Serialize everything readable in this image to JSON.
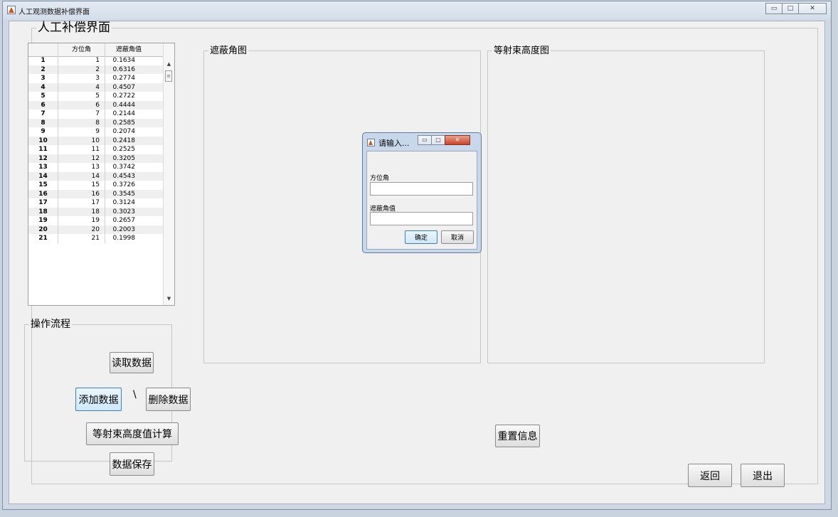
{
  "window": {
    "title": "人工观测数据补偿界面"
  },
  "main": {
    "title": "人工补偿界面"
  },
  "table": {
    "headers": [
      "",
      "方位角",
      "遮蔽角值"
    ],
    "rows": [
      [
        "1",
        "1",
        "0.1634"
      ],
      [
        "2",
        "2",
        "0.6316"
      ],
      [
        "3",
        "3",
        "0.2774"
      ],
      [
        "4",
        "4",
        "0.4507"
      ],
      [
        "5",
        "5",
        "0.2722"
      ],
      [
        "6",
        "6",
        "0.4444"
      ],
      [
        "7",
        "7",
        "0.2144"
      ],
      [
        "8",
        "8",
        "0.2585"
      ],
      [
        "9",
        "9",
        "0.2074"
      ],
      [
        "10",
        "10",
        "0.2418"
      ],
      [
        "11",
        "11",
        "0.2525"
      ],
      [
        "12",
        "12",
        "0.3205"
      ],
      [
        "13",
        "13",
        "0.3742"
      ],
      [
        "14",
        "14",
        "0.4543"
      ],
      [
        "15",
        "15",
        "0.3726"
      ],
      [
        "16",
        "16",
        "0.3545"
      ],
      [
        "17",
        "17",
        "0.3124"
      ],
      [
        "18",
        "18",
        "0.3023"
      ],
      [
        "19",
        "19",
        "0.2657"
      ],
      [
        "20",
        "20",
        "0.2003"
      ],
      [
        "21",
        "21",
        "0.1998"
      ]
    ]
  },
  "panels": {
    "shade_title": "遮蔽角图",
    "height_title": "等射束高度图"
  },
  "operations": {
    "title": "操作流程",
    "read": "读取数据",
    "add": "添加数据",
    "separator": "\\",
    "delete": "删除数据",
    "compute": "等射束高度值计算",
    "save": "数据保存"
  },
  "buttons": {
    "reset": "重置信息",
    "back": "返回",
    "exit": "退出"
  },
  "dialog": {
    "title": "请输入...",
    "azimuth_label": "方位角",
    "shade_label": "遮蔽角值",
    "ok": "确定",
    "cancel": "取消"
  },
  "colors": {
    "app_icon": "#d3541d",
    "focus_button": "#cfe8f9",
    "dialog_close": "#c9442a"
  }
}
